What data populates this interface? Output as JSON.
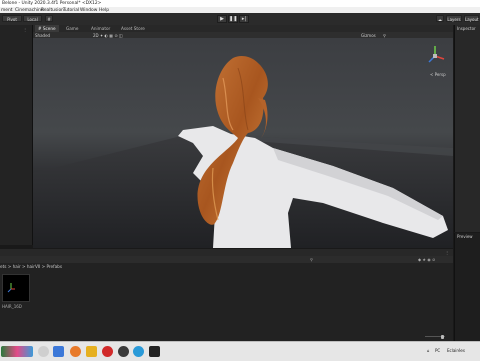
{
  "window": {
    "title": "Belone - Unity 2020.3.4f1 Personal* <DX12>"
  },
  "menubar": {
    "items": [
      "ment",
      "Cinemachine",
      "Realtusion",
      "Tutorial",
      "Window",
      "Help"
    ]
  },
  "toolbar": {
    "pivot_label": "Pivot",
    "local_label": "Local",
    "layers_label": "Layers",
    "layout_label": "Layout"
  },
  "scene": {
    "tabs": [
      "# Scene",
      "Game",
      "Animator",
      "Asset Store"
    ],
    "shading_mode": "Shaded",
    "gizmos_label": "Gizmos",
    "persp_label": "< Persp"
  },
  "inspector": {
    "title": "Inspector",
    "preview_title": "Preview"
  },
  "project": {
    "breadcrumb": "ets > hair > hairVII > Prefabs",
    "asset_name": "HAIR_16D",
    "slider_value": 0.2
  },
  "taskbar": {
    "region_label": "PC",
    "language_label": "Eclairées",
    "icons": [
      "start-icon",
      "search-icon",
      "taskview-icon",
      "edge-icon",
      "firefox-icon",
      "explorer-icon",
      "opera-icon",
      "chrome-icon",
      "steam-icon",
      "unity-icon"
    ]
  },
  "colors": {
    "hair": "#b8632a",
    "skin": "#e9e9ea",
    "accent": "#3c78d8"
  }
}
